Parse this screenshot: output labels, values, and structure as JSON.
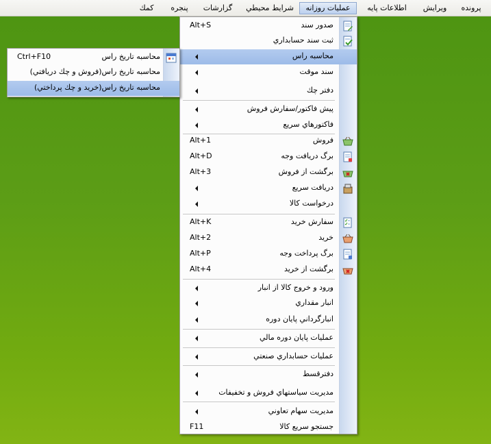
{
  "menubar": {
    "file": "پرونده",
    "edit": "ويرايش",
    "base_info": "اطلاعات پايه",
    "daily_ops": "عمليات روزانه",
    "env": "شرايط محيطي",
    "reports": "گزارشات",
    "window": "پنجره",
    "help": "كمك"
  },
  "menu": {
    "issue_doc": "صدور سند",
    "issue_doc_sc": "Alt+S",
    "record_acc_doc": "ثبت سند حسابداري",
    "due_calc": "محاسبه راس",
    "temp_doc": "سند موقت",
    "cheque_book": "دفتر چك",
    "preinvoice": "پيش فاكتور/سفارش فروش",
    "quick_invoices": "فاكتورهاي سريع",
    "sales": "فروش",
    "sales_sc": "Alt+1",
    "receipt_voucher": "برگ دريافت وجه",
    "receipt_voucher_sc": "Alt+D",
    "sales_return": "برگشت از فروش",
    "sales_return_sc": "Alt+3",
    "quick_receipt": "دريافت سريع",
    "goods_request": "درخواست كالا",
    "purchase_order": "سفارش خريد",
    "purchase_order_sc": "Alt+K",
    "purchase": "خريد",
    "purchase_sc": "Alt+2",
    "payment_voucher": "برگ پرداخت وجه",
    "payment_voucher_sc": "Alt+P",
    "purchase_return": "برگشت از خريد",
    "purchase_return_sc": "Alt+4",
    "warehouse_io": "ورود و خروج كالا از انبار",
    "qty_warehouse": "انبار مقداري",
    "stocktake": "انبارگرداني پايان دوره",
    "fiscal_end": "عمليات پايان دوره مالي",
    "industrial_acc": "عمليات حسابداري صنعتي",
    "installment": "دفترقسط",
    "sales_policy": "مديريت سياستهاي فروش و تخفيفات",
    "coop_shares": "مديريت سهام تعاوني",
    "quick_search": "جستجو سريع كالا",
    "quick_search_sc": "F11"
  },
  "submenu": {
    "due_date_calc": "محاسبه تاريخ راس",
    "due_date_calc_sc": "Ctrl+F10",
    "due_date_sales": "محاسبه تاريخ راس(فروش و چك دريافتي)",
    "due_date_purchase": "محاسبه تاريخ راس(خريد و چك پرداختي)"
  },
  "colors": {
    "desktop": "#5c9d16",
    "highlight": "#a8c3ec"
  }
}
